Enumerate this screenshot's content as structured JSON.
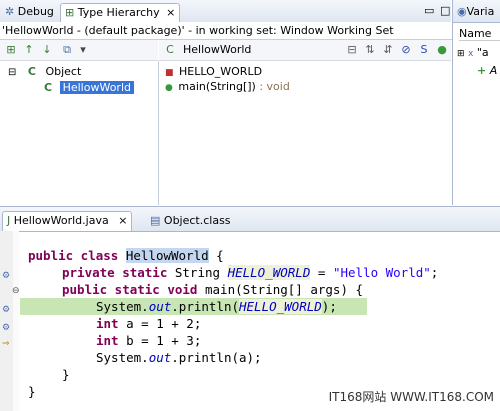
{
  "tabs": {
    "debug": "Debug",
    "type_hierarchy": "Type Hierarchy",
    "variables": "Varia"
  },
  "hierarchy": {
    "status": "'HellowWorld - (default package)' - in working set: Window Working Set",
    "tree": [
      {
        "label": "Object"
      },
      {
        "label": "HellowWorld"
      }
    ],
    "members_header": "HellowWorld",
    "members": [
      {
        "name": "HELLO_WORLD",
        "type": ""
      },
      {
        "name": "main(String[])",
        "type": ": void"
      }
    ]
  },
  "variables": {
    "col_header": "Name",
    "row1": "\"a",
    "row2": "A"
  },
  "editor": {
    "tabs": [
      {
        "label": "HellowWorld.java"
      },
      {
        "label": "Object.class"
      }
    ]
  },
  "code": {
    "l1_kw": "public class",
    "l1_name": "HellowWorld",
    "l1_end": " {",
    "l2_kw": "private static",
    "l2_type": " String ",
    "l2_field": "HELLO_WORLD",
    "l2_eq": " = ",
    "l2_str": "\"Hello World\"",
    "l2_end": ";",
    "l3_kw": "public static void",
    "l3_rest": " main(String[] args) {",
    "l4_a": "System.",
    "l4_out": "out",
    "l4_b": ".println(",
    "l4_field": "HELLO_WORLD",
    "l4_c": ");",
    "l5_kw": "int",
    "l5_rest": " a = 1 + 2;",
    "l6_kw": "int",
    "l6_rest": " b = 1 + 3;",
    "l7_a": "System.",
    "l7_out": "out",
    "l7_b": ".println(a);",
    "l8": "}",
    "l9": "}"
  },
  "watermark": "IT168网站 WWW.IT168.COM"
}
